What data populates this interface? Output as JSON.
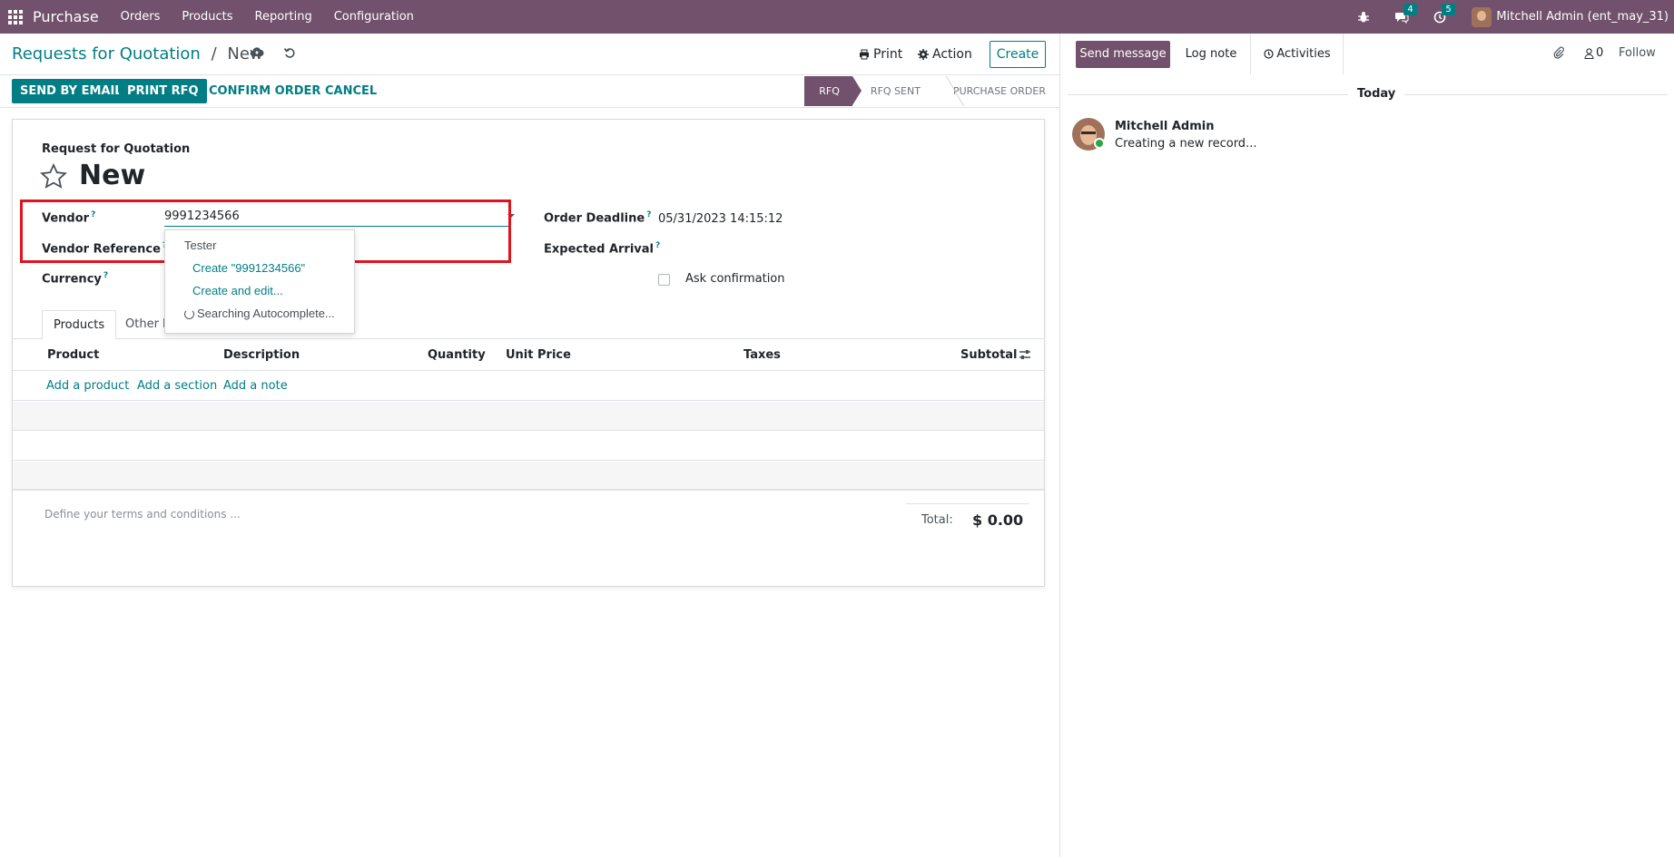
{
  "navbar": {
    "brand": "Purchase",
    "menu": [
      "Orders",
      "Products",
      "Reporting",
      "Configuration"
    ],
    "messages_count": "4",
    "activities_count": "5",
    "user": "Mitchell Admin (ent_may_31)",
    "bg_color": "#71516c"
  },
  "control_panel": {
    "breadcrumb_parent": "Requests for Quotation",
    "breadcrumb_separator": "/",
    "breadcrumb_current": "New",
    "print_label": "Print",
    "action_label": "Action",
    "create_label": "Create"
  },
  "statusbar": {
    "buttons": [
      "SEND BY EMAIL",
      "PRINT RFQ",
      "CONFIRM ORDER",
      "CANCEL"
    ],
    "stages": [
      "RFQ",
      "RFQ SENT",
      "PURCHASE ORDER"
    ],
    "active_stage": "RFQ"
  },
  "form": {
    "subtitle": "Request for Quotation",
    "title": "New",
    "vendor_label": "Vendor",
    "vendor_value": "9991234566",
    "vendor_reference_label": "Vendor Reference",
    "currency_label": "Currency",
    "order_deadline_label": "Order Deadline",
    "order_deadline_value": "05/31/2023 14:15:12",
    "expected_arrival_label": "Expected Arrival",
    "ask_confirmation_label": "Ask confirmation",
    "help_mark": "?"
  },
  "autocomplete": {
    "items": [
      "Tester",
      "Create \"9991234566\"",
      "Create and edit...",
      "Searching Autocomplete..."
    ]
  },
  "tabs": [
    "Products",
    "Other In"
  ],
  "order_lines": {
    "columns": [
      "Product",
      "Description",
      "Quantity",
      "Unit Price",
      "Taxes",
      "Subtotal"
    ],
    "add_links": [
      "Add a product",
      "Add a section",
      "Add a note"
    ]
  },
  "footer": {
    "terms_placeholder": "Define your terms and conditions ...",
    "total_label": "Total:",
    "total_value": "$ 0.00"
  },
  "chatter": {
    "send_message": "Send message",
    "log_note": "Log note",
    "activities": "Activities",
    "followers_count": "0",
    "follow": "Follow",
    "date_separator": "Today",
    "message": {
      "author": "Mitchell Admin",
      "body": "Creating a new record..."
    }
  },
  "colors": {
    "accent": "#017e84",
    "brand": "#71516c",
    "highlight": "#e1141e"
  }
}
